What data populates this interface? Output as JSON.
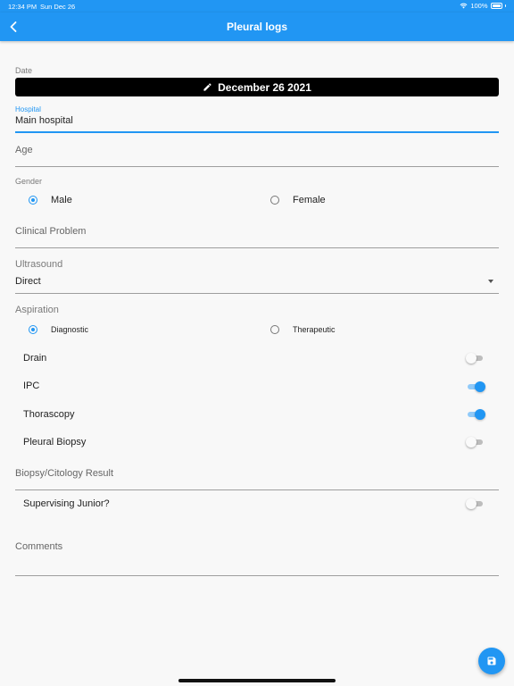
{
  "status_bar": {
    "time": "12:34 PM",
    "date": "Sun Dec 26",
    "battery": "100%"
  },
  "app_bar": {
    "title": "Pleural logs",
    "back_icon": "chevron-left-icon"
  },
  "form": {
    "date_label": "Date",
    "date_value": "December 26 2021",
    "hospital_label": "Hospital",
    "hospital_value": "Main hospital",
    "age_placeholder": "Age",
    "gender_label": "Gender",
    "gender_options": [
      {
        "label": "Male",
        "selected": true
      },
      {
        "label": "Female",
        "selected": false
      }
    ],
    "clinical_problem_placeholder": "Clinical Problem",
    "ultrasound_label": "Ultrasound",
    "ultrasound_value": "Direct",
    "aspiration_label": "Aspiration",
    "aspiration_options": [
      {
        "label": "Diagnostic",
        "selected": true
      },
      {
        "label": "Therapeutic",
        "selected": false
      }
    ],
    "switches": [
      {
        "label": "Drain",
        "on": false
      },
      {
        "label": "IPC",
        "on": true
      },
      {
        "label": "Thorascopy",
        "on": true
      },
      {
        "label": "Pleural Biopsy",
        "on": false
      }
    ],
    "biopsy_placeholder": "Biopsy/Citology Result",
    "supervising": {
      "label": "Supervising Junior?",
      "on": false
    },
    "comments_placeholder": "Comments"
  },
  "fab": {
    "icon": "save-icon"
  },
  "colors": {
    "primary": "#2196f3",
    "date_button": "#000000"
  }
}
